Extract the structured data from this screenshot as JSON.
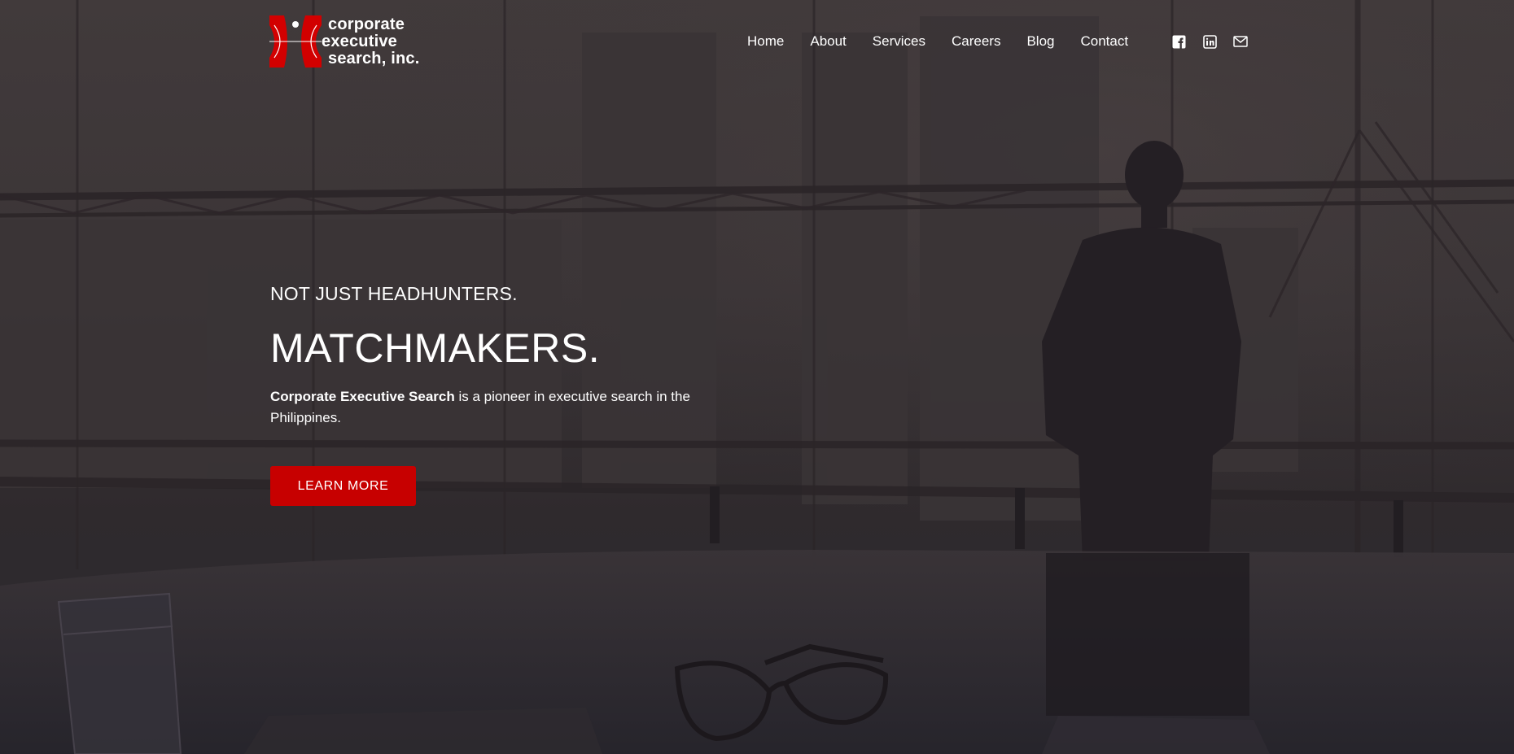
{
  "header": {
    "logo": {
      "line1": "corporate",
      "line2": "executive",
      "line3": "search, inc."
    },
    "nav": [
      {
        "label": "Home"
      },
      {
        "label": "About"
      },
      {
        "label": "Services"
      },
      {
        "label": "Careers"
      },
      {
        "label": "Blog"
      },
      {
        "label": "Contact"
      }
    ],
    "social_icons": [
      "facebook-icon",
      "linkedin-icon",
      "email-icon"
    ]
  },
  "hero": {
    "kicker": "NOT JUST HEADHUNTERS.",
    "headline": "MATCHMAKERS.",
    "lead_bold": "Corporate Executive Search",
    "lead_rest": " is a pioneer in executive search in the Philippines.",
    "cta_label": "LEARN MORE"
  },
  "colors": {
    "brand_red": "#c70000",
    "overlay": "#3b3537",
    "text": "#ffffff"
  }
}
